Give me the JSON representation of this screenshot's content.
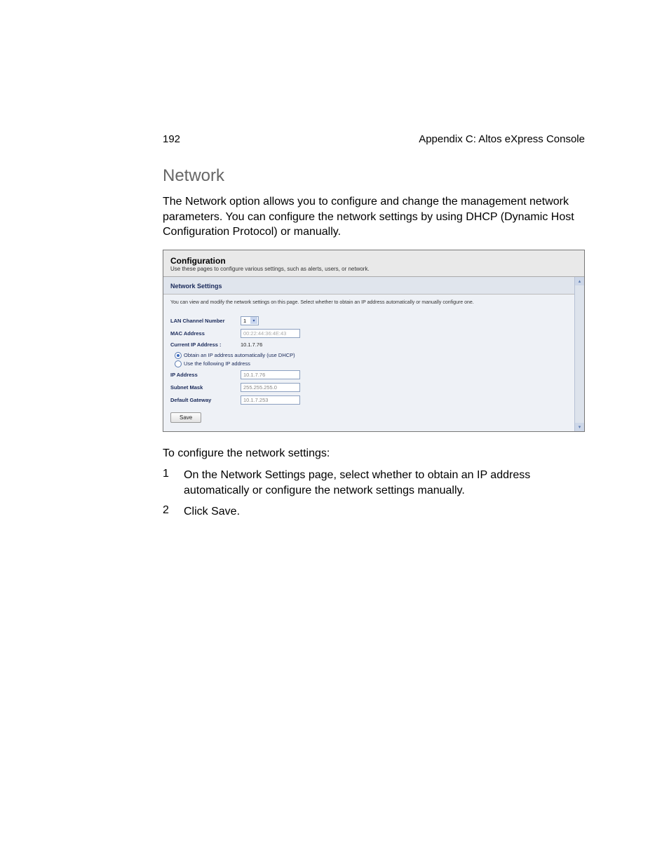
{
  "header": {
    "pageNum": "192",
    "chapter": "Appendix C: Altos eXpress Console"
  },
  "section": {
    "title": "Network",
    "intro": "The Network option allows you to configure and change the management network parameters. You can configure the network settings by using DHCP (Dynamic Host Configuration Protocol) or manually."
  },
  "screenshot": {
    "confTitle": "Configuration",
    "confSub": "Use these pages to configure various settings, such as alerts, users, or network.",
    "panelTitle": "Network Settings",
    "panelDesc": "You can view and modify the network settings on this page. Select whether to obtain an IP address automatically or manually configure one.",
    "rows": {
      "lanLabel": "LAN Channel Number",
      "lanValue": "1",
      "macLabel": "MAC Address",
      "macValue": "00:22:44:36:4E:43",
      "curIpLabel": "Current IP Address :",
      "curIpValue": "10.1.7.76",
      "radio1": "Obtain an IP address automatically (use DHCP)",
      "radio2": "Use the following IP address",
      "ipLabel": "IP Address",
      "ipValue": "10.1.7.76",
      "maskLabel": "Subnet Mask",
      "maskValue": "255.255.255.0",
      "gwLabel": "Default Gateway",
      "gwValue": "10.1.7.253",
      "saveBtn": "Save"
    }
  },
  "instructions": {
    "lead": "To configure the network settings:",
    "step1num": "1",
    "step1": "On the Network Settings page, select whether to obtain an IP address automatically or configure the network settings manually.",
    "step2num": "2",
    "step2": "Click Save."
  }
}
